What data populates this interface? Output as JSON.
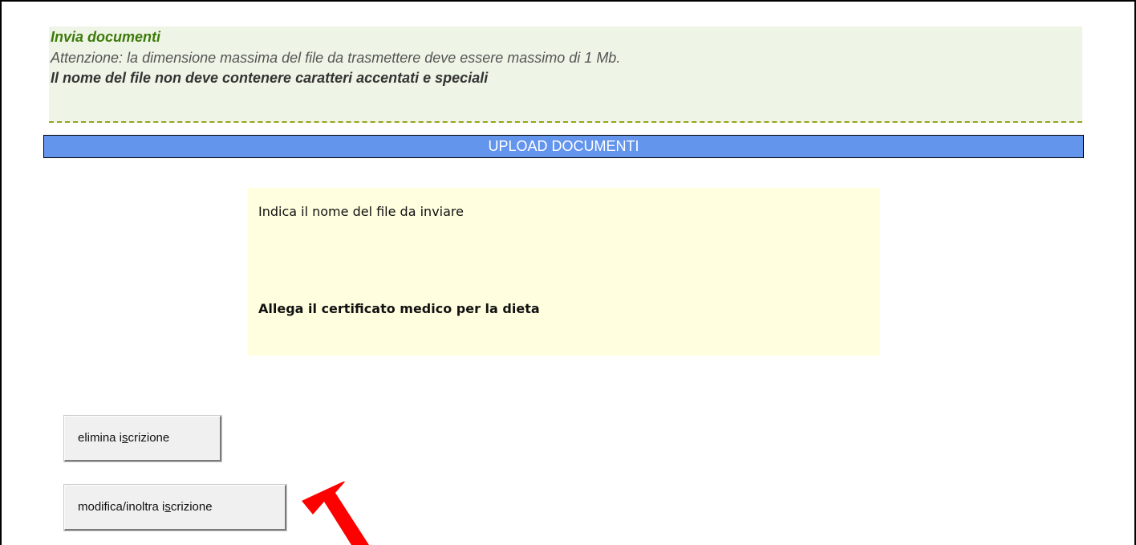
{
  "notice": {
    "title": "Invia documenti",
    "warning": "Attenzione: la dimensione massima del file da trasmettere deve essere massimo di 1 Mb.",
    "rule": "Il nome del file non deve contenere caratteri accentati e speciali"
  },
  "section": {
    "title": "UPLOAD DOCUMENTI"
  },
  "upload": {
    "prompt": "Indica il nome del file da inviare",
    "attach_label": "Allega il certificato medico per la dieta"
  },
  "buttons": {
    "delete": {
      "pre": "elimina i",
      "accel": "s",
      "post": "crizione"
    },
    "submit": {
      "pre": "modifica/inoltra i",
      "accel": "s",
      "post": "crizione"
    }
  },
  "colors": {
    "section_bar": "#6495ed",
    "notice_bg": "#eef5e6",
    "notice_title": "#3d7a0a",
    "upload_bg": "#ffffe0",
    "arrow": "#ff0000"
  },
  "icons": {
    "annotation": "red-arrow-icon"
  }
}
